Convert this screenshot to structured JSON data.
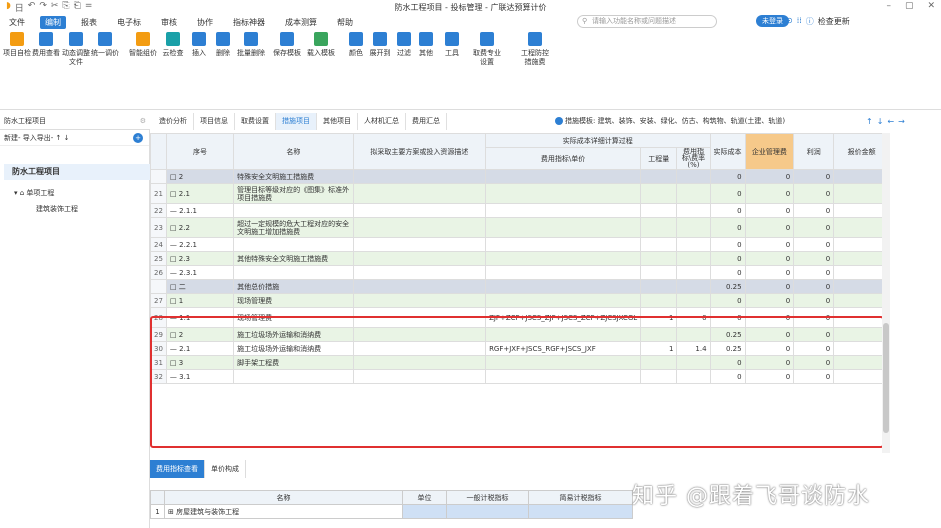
{
  "titlebar": {
    "title": "防水工程项目 - 投标管理 - 广联达预算计价",
    "quick": [
      "日",
      "↶",
      "↷",
      "✂",
      "⎘",
      "⎗",
      "="
    ],
    "win": [
      "–",
      "▢",
      "✕"
    ]
  },
  "menu": {
    "items": [
      "文件",
      "编制",
      "报表",
      "电子标",
      "审核",
      "协作",
      "指标神器",
      "成本测算",
      "帮助"
    ],
    "search_placeholder": "请输入功能名称或问题描述",
    "login": "未登录",
    "update": "检查更新"
  },
  "ribbon": {
    "buttons": [
      "项目自检",
      "费用查看",
      "动态调整\n文件",
      "统一调价",
      "智能组价",
      "云检查",
      "插入",
      "删除",
      "批量删除",
      "保存模板",
      "载入模板",
      "颜色",
      "展开到",
      "过滤",
      "其他",
      "工具",
      "取费专业\n设置",
      "工程防控\n措施费"
    ]
  },
  "left_panel": {
    "header": "防水工程项目",
    "toolbar": "新建- 导入导出- ↑ ↓",
    "root": "防水工程项目",
    "child": "单项工程",
    "leaf": "建筑装饰工程"
  },
  "tabs": [
    "造价分析",
    "项目信息",
    "取费设置",
    "措施项目",
    "其他项目",
    "人材机汇总",
    "费用汇总"
  ],
  "active_tab": "措施项目",
  "template_text": "措施模板: 建筑、装饰、安装、绿化、仿古、构筑物、轨道(土建、轨道)",
  "table": {
    "headers": {
      "seq": "序号",
      "name": "名称",
      "desc": "拟采取主要方案或投入资源描述",
      "group": "实际成本详细计算过程",
      "unit": "费用指标\\单价",
      "qty": "工程量",
      "rate": "费用指标\\费率(%)",
      "cost": "实际成本",
      "mgmt": "企业管理费",
      "profit": "利润",
      "tax": "报价金额"
    },
    "rows": [
      {
        "rn": "",
        "seq": "□ 2",
        "name": "特殊安全文明施工措施费",
        "desc": "",
        "unit": "",
        "qty": "",
        "rate": "",
        "cost": "0",
        "mgmt": "0",
        "profit": "0",
        "cls": "hl",
        "tall": false
      },
      {
        "rn": "21",
        "seq": "□ 2.1",
        "name": "管理目标等级对应的《图集》标准外项目措施费",
        "desc": "",
        "unit": "",
        "qty": "",
        "rate": "",
        "cost": "0",
        "mgmt": "0",
        "profit": "0",
        "cls": "g",
        "tall": true
      },
      {
        "rn": "22",
        "seq": "— 2.1.1",
        "name": "",
        "desc": "",
        "unit": "",
        "qty": "",
        "rate": "",
        "cost": "0",
        "mgmt": "0",
        "profit": "0",
        "cls": "",
        "tall": false
      },
      {
        "rn": "23",
        "seq": "□ 2.2",
        "name": "超过一定规模的危大工程对应的安全文明施工增加措施费",
        "desc": "",
        "unit": "",
        "qty": "",
        "rate": "",
        "cost": "0",
        "mgmt": "0",
        "profit": "0",
        "cls": "g",
        "tall": true
      },
      {
        "rn": "24",
        "seq": "— 2.2.1",
        "name": "",
        "desc": "",
        "unit": "",
        "qty": "",
        "rate": "",
        "cost": "0",
        "mgmt": "0",
        "profit": "0",
        "cls": "",
        "tall": false
      },
      {
        "rn": "25",
        "seq": "□ 2.3",
        "name": "其他特殊安全文明施工措施费",
        "desc": "",
        "unit": "",
        "qty": "",
        "rate": "",
        "cost": "0",
        "mgmt": "0",
        "profit": "0",
        "cls": "g",
        "tall": false
      },
      {
        "rn": "26",
        "seq": "— 2.3.1",
        "name": "",
        "desc": "",
        "unit": "",
        "qty": "",
        "rate": "",
        "cost": "0",
        "mgmt": "0",
        "profit": "0",
        "cls": "",
        "tall": false
      },
      {
        "rn": "",
        "seq": "□ 二",
        "name": "其他总价措施",
        "desc": "",
        "unit": "",
        "qty": "",
        "rate": "",
        "cost": "0.25",
        "mgmt": "0",
        "profit": "0",
        "cls": "hl",
        "tall": false
      },
      {
        "rn": "27",
        "seq": "□ 1",
        "name": "现场管理费",
        "desc": "",
        "unit": "",
        "qty": "",
        "rate": "",
        "cost": "0",
        "mgmt": "0",
        "profit": "0",
        "cls": "g",
        "tall": false
      },
      {
        "rn": "28",
        "seq": "— 1.1",
        "name": "现场管理费",
        "desc": "",
        "unit": "ZJF+ZCF+JSCS_ZJF+JSCS_ZCF+ZJCSJXCGL",
        "qty": "1",
        "rate": "0",
        "cost": "0",
        "mgmt": "0",
        "profit": "0",
        "cls": "",
        "tall": true
      },
      {
        "rn": "29",
        "seq": "□ 2",
        "name": "施工垃圾场外运输和消纳费",
        "desc": "",
        "unit": "",
        "qty": "",
        "rate": "",
        "cost": "0.25",
        "mgmt": "0",
        "profit": "0",
        "cls": "g",
        "tall": false
      },
      {
        "rn": "30",
        "seq": "— 2.1",
        "name": "施工垃圾场外运输和消纳费",
        "desc": "",
        "unit": "RGF+JXF+JSCS_RGF+JSCS_JXF",
        "qty": "1",
        "rate": "1.4",
        "cost": "0.25",
        "mgmt": "0",
        "profit": "0",
        "cls": "",
        "tall": false
      },
      {
        "rn": "31",
        "seq": "□ 3",
        "name": "脚手架工程费",
        "desc": "",
        "unit": "",
        "qty": "",
        "rate": "",
        "cost": "0",
        "mgmt": "0",
        "profit": "0",
        "cls": "g",
        "tall": false
      },
      {
        "rn": "32",
        "seq": "— 3.1",
        "name": "",
        "desc": "",
        "unit": "",
        "qty": "",
        "rate": "",
        "cost": "0",
        "mgmt": "0",
        "profit": "0",
        "cls": "",
        "tall": false
      }
    ]
  },
  "bottom": {
    "tabs": [
      "费用指标查看",
      "单价构成"
    ],
    "headers": [
      "名称",
      "单位",
      "一般计税指标",
      "简易计税指标"
    ],
    "row": {
      "rn": "1",
      "name": "⊞ 房屋建筑与装饰工程"
    }
  },
  "watermark": "知乎 @跟着飞哥谈防水"
}
